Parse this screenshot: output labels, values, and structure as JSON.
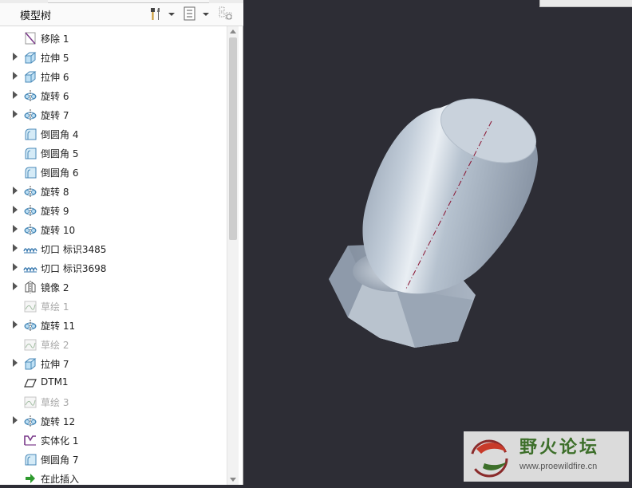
{
  "panel": {
    "title": "模型树"
  },
  "tree": {
    "items": [
      {
        "label": "移除 1",
        "icon": "remove-feature-icon",
        "expandable": false,
        "dim": false
      },
      {
        "label": "拉伸 5",
        "icon": "extrude-icon",
        "expandable": true,
        "dim": false
      },
      {
        "label": "拉伸 6",
        "icon": "extrude-icon",
        "expandable": true,
        "dim": false
      },
      {
        "label": "旋转 6",
        "icon": "revolve-icon",
        "expandable": true,
        "dim": false
      },
      {
        "label": "旋转 7",
        "icon": "revolve-icon",
        "expandable": true,
        "dim": false
      },
      {
        "label": "倒圆角 4",
        "icon": "round-icon",
        "expandable": false,
        "dim": false
      },
      {
        "label": "倒圆角 5",
        "icon": "round-icon",
        "expandable": false,
        "dim": false
      },
      {
        "label": "倒圆角 6",
        "icon": "round-icon",
        "expandable": false,
        "dim": false
      },
      {
        "label": "旋转 8",
        "icon": "revolve-icon",
        "expandable": true,
        "dim": false
      },
      {
        "label": "旋转 9",
        "icon": "revolve-icon",
        "expandable": true,
        "dim": false
      },
      {
        "label": "旋转 10",
        "icon": "revolve-icon",
        "expandable": true,
        "dim": false
      },
      {
        "label": "切口 标识3485",
        "icon": "cosmetic-thread-icon",
        "expandable": true,
        "dim": false
      },
      {
        "label": "切口 标识3698",
        "icon": "cosmetic-thread-icon",
        "expandable": true,
        "dim": false
      },
      {
        "label": "镜像 2",
        "icon": "mirror-icon",
        "expandable": true,
        "dim": false
      },
      {
        "label": "草绘 1",
        "icon": "sketch-icon",
        "expandable": false,
        "dim": true
      },
      {
        "label": "旋转 11",
        "icon": "revolve-icon",
        "expandable": true,
        "dim": false
      },
      {
        "label": "草绘 2",
        "icon": "sketch-icon",
        "expandable": false,
        "dim": true
      },
      {
        "label": "拉伸 7",
        "icon": "extrude-icon",
        "expandable": true,
        "dim": false
      },
      {
        "label": "DTM1",
        "icon": "datum-plane-icon",
        "expandable": false,
        "dim": false
      },
      {
        "label": "草绘 3",
        "icon": "sketch-icon",
        "expandable": false,
        "dim": true
      },
      {
        "label": "旋转 12",
        "icon": "revolve-icon",
        "expandable": true,
        "dim": false
      },
      {
        "label": "实体化 1",
        "icon": "solidify-icon",
        "expandable": false,
        "dim": false
      },
      {
        "label": "倒圆角 7",
        "icon": "round-icon",
        "expandable": false,
        "dim": false
      },
      {
        "label": "在此插入",
        "icon": "insert-here-arrow-icon",
        "expandable": false,
        "dim": false
      }
    ]
  },
  "watermark": {
    "title": "野火论坛",
    "url": "www.proewildfire.cn"
  },
  "colors": {
    "viewport_bg": "#2d2d35",
    "model": "#a6b3c2"
  }
}
